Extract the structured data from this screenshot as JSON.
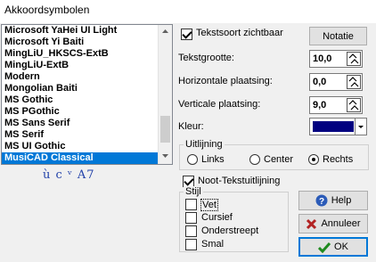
{
  "window": {
    "title": "Akkoordsymbolen"
  },
  "fonts": {
    "items": [
      "Microsoft YaHei UI Light",
      "Microsoft Yi Baiti",
      "MingLiU_HKSCS-ExtB",
      "MingLiU-ExtB",
      "Modern",
      "Mongolian Baiti",
      "MS Gothic",
      "MS PGothic",
      "MS Sans Serif",
      "MS Serif",
      "MS UI Gothic",
      "MusiCAD Classical"
    ],
    "selected": "MusiCAD Classical",
    "preview": "ù c ᵛ A7"
  },
  "options": {
    "show_font_label": "Tekstsoort zichtbaar",
    "show_font_checked": true,
    "notation_button": "Notatie",
    "size_label": "Tekstgrootte:",
    "size_value": "10,0",
    "hpos_label": "Horizontale plaatsing:",
    "hpos_value": "0,0",
    "vpos_label": "Verticale plaatsing:",
    "vpos_value": "9,0",
    "color_label": "Kleur:",
    "color_value": "#000080"
  },
  "alignment": {
    "title": "Uitlijning",
    "left": "Links",
    "center": "Center",
    "right": "Rechts",
    "selected": "Rechts"
  },
  "note_alignment": {
    "label": "Noot-Tekstuitlijning",
    "checked": true
  },
  "style": {
    "title": "Stijl",
    "bold": "Vet",
    "italic": "Cursief",
    "underline": "Onderstreept",
    "narrow": "Smal"
  },
  "buttons": {
    "help": "Help",
    "cancel": "Annuleer",
    "ok": "OK"
  }
}
